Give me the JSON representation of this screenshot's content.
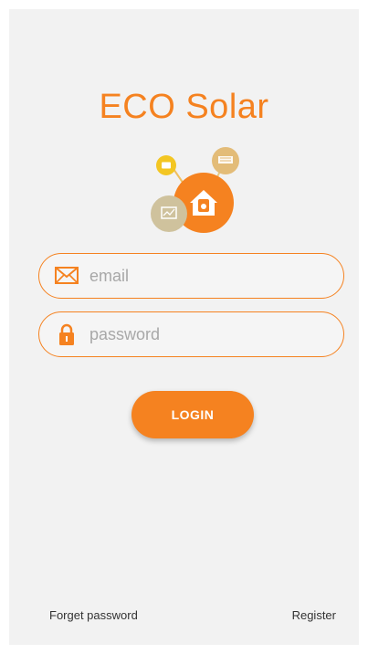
{
  "app": {
    "title": "ECO Solar"
  },
  "form": {
    "email_placeholder": "email",
    "password_placeholder": "password",
    "login_label": "LOGIN"
  },
  "footer": {
    "forget_label": "Forget password",
    "register_label": "Register"
  },
  "icons": {
    "email": "envelope-icon",
    "password": "lock-icon",
    "logo": "eco-solar-logo"
  },
  "colors": {
    "accent": "#f58220",
    "background": "#f2f2f2",
    "placeholder": "#a8a8a8"
  }
}
